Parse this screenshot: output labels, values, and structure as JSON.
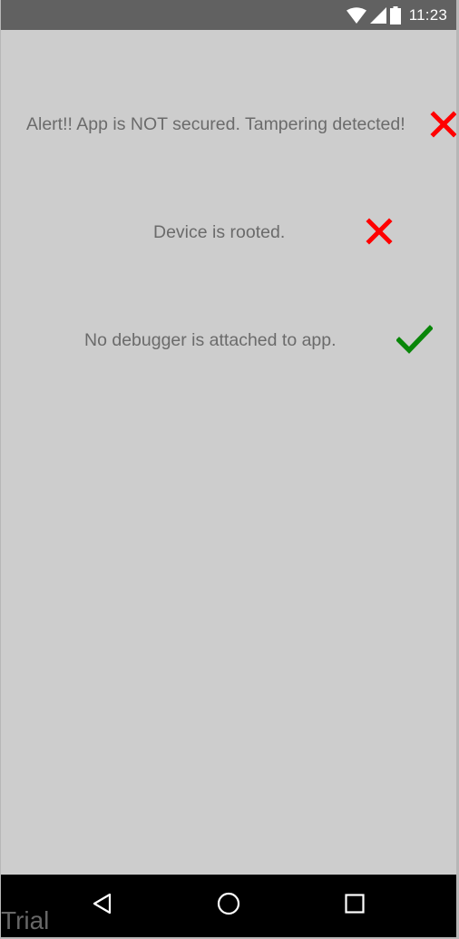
{
  "status_bar": {
    "time": "11:23",
    "icons": [
      "wifi-icon",
      "cell-signal-icon",
      "battery-icon"
    ]
  },
  "checks": [
    {
      "text": "Alert!! App is NOT secured. Tampering detected!",
      "status": "fail",
      "icon": "red-x-icon"
    },
    {
      "text": "Device is rooted.",
      "status": "fail",
      "icon": "red-x-icon"
    },
    {
      "text": "No debugger is attached to app.",
      "status": "pass",
      "icon": "green-check-icon"
    }
  ],
  "nav": {
    "buttons": [
      "back-icon",
      "home-icon",
      "recents-icon"
    ],
    "watermark": "Trial"
  },
  "colors": {
    "background": "#cdcdcd",
    "status_bar": "#616161",
    "text": "#6b6b6b",
    "fail": "#ff0000",
    "pass": "#098609",
    "nav_bar": "#000000"
  }
}
